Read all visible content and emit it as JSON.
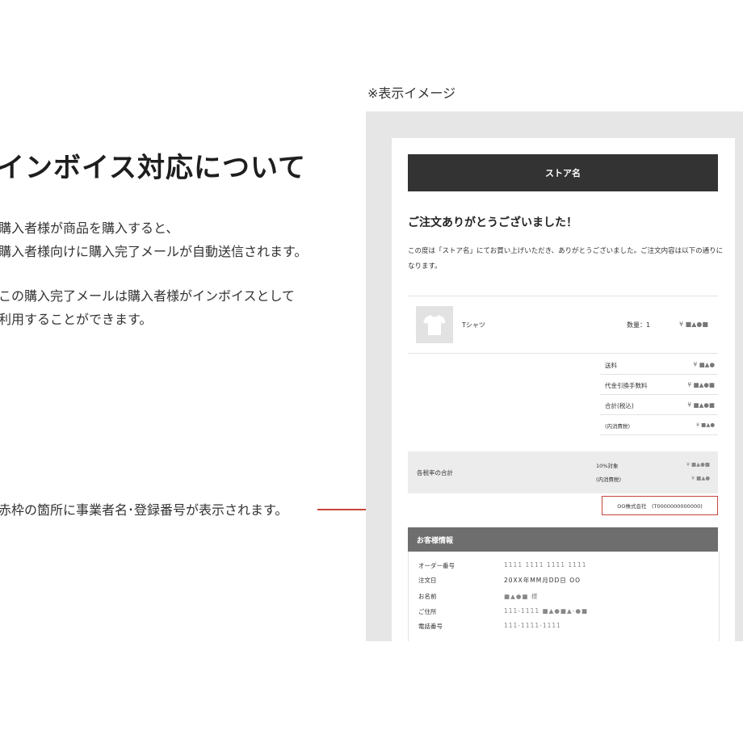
{
  "left": {
    "title": "インボイス対応について",
    "para1_line1": "購入者様が商品を購入すると、",
    "para1_line2": "購入者様向けに購入完了メールが自動送信されます。",
    "para2_line1": "この購入完了メールは購入者様がインボイスとして",
    "para2_line2": "利用することができます。",
    "callout": "赤枠の箇所に事業者名･登録番号が表示されます。"
  },
  "preview": {
    "caption": "※表示イメージ",
    "store_name": "ストア名",
    "thanks": "ご注文ありがとうございました！",
    "intro": "この度は「ストア名」にてお買い上げいただき、ありがとうございました。ご注文内容は以下の通りになります。",
    "item": {
      "name": "Tシャツ",
      "qty": "数量：1",
      "price": "¥ ■▲●■"
    },
    "summary": [
      {
        "label": "送料",
        "value": "¥ ■▲●"
      },
      {
        "label": "代金引換手数料",
        "value": "¥ ■▲●■"
      },
      {
        "label": "合計(税込)",
        "value": "¥ ■▲●■"
      },
      {
        "label": "(内消費税)",
        "value": "¥ ■▲●"
      }
    ],
    "tax": {
      "label": "各税率の合計",
      "rate_label": "10%対象",
      "rate_value": "¥ ■▲●■",
      "inner_label": "(内消費税)",
      "inner_value": "¥ ■▲●"
    },
    "invoice": "OO株式会社　(T0000000000000)",
    "customer": {
      "header": "お客様情報",
      "rows": [
        {
          "key": "オーダー番号",
          "value": "1111 1111 1111 1111"
        },
        {
          "key": "注文日",
          "value": "20XX年MM月DD日  OO"
        },
        {
          "key": "お名前",
          "value": "■▲●■ 様"
        },
        {
          "key": "ご住所",
          "value": "111-1111 ■▲●■▲-●■"
        },
        {
          "key": "電話番号",
          "value": "111-1111-1111"
        }
      ]
    }
  },
  "colors": {
    "accent_red": "#c8453a",
    "dark_bar": "#333333",
    "gray_bar": "#6e6e6e"
  }
}
